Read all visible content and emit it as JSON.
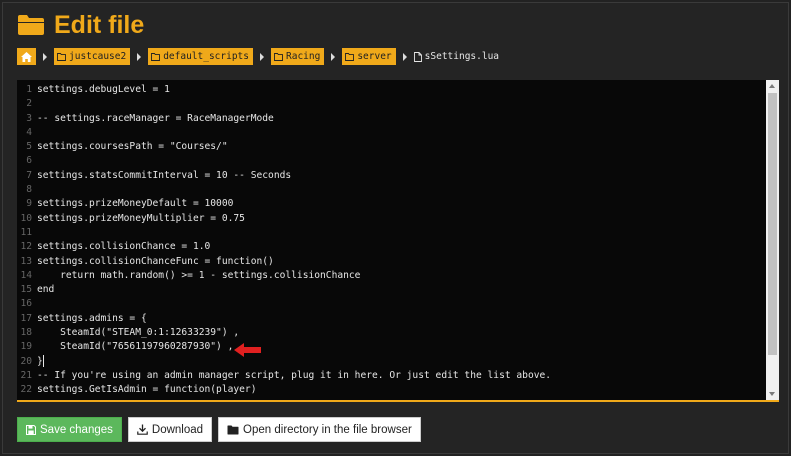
{
  "page": {
    "title": "Edit file"
  },
  "breadcrumb": {
    "folders": [
      "justcause2",
      "default_scripts",
      "Racing",
      "server"
    ],
    "current_file": "sSettings.lua"
  },
  "editor": {
    "lines": [
      {
        "n": "1",
        "text": "settings.debugLevel = 1"
      },
      {
        "n": "2",
        "text": ""
      },
      {
        "n": "3",
        "text": "-- settings.raceManager = RaceManagerMode"
      },
      {
        "n": "4",
        "text": ""
      },
      {
        "n": "5",
        "text": "settings.coursesPath = \"Courses/\""
      },
      {
        "n": "6",
        "text": ""
      },
      {
        "n": "7",
        "text": "settings.statsCommitInterval = 10 -- Seconds"
      },
      {
        "n": "8",
        "text": ""
      },
      {
        "n": "9",
        "text": "settings.prizeMoneyDefault = 10000"
      },
      {
        "n": "10",
        "text": "settings.prizeMoneyMultiplier = 0.75"
      },
      {
        "n": "11",
        "text": ""
      },
      {
        "n": "12",
        "text": "settings.collisionChance = 1.0"
      },
      {
        "n": "13",
        "text": "settings.collisionChanceFunc = function()"
      },
      {
        "n": "14",
        "text": "    return math.random() >= 1 - settings.collisionChance"
      },
      {
        "n": "15",
        "text": "end"
      },
      {
        "n": "16",
        "text": ""
      },
      {
        "n": "17",
        "text": "settings.admins = {"
      },
      {
        "n": "18",
        "text": "    SteamId(\"STEAM_0:1:12633239\") ,"
      },
      {
        "n": "19",
        "text": "    SteamId(\"76561197960287930\") ,"
      },
      {
        "n": "20",
        "text": "}"
      },
      {
        "n": "21",
        "text": "-- If you're using an admin manager script, plug it in here. Or just edit the list above."
      },
      {
        "n": "22",
        "text": "settings.GetIsAdmin = function(player)"
      }
    ]
  },
  "actions": {
    "save_label": "Save changes",
    "download_label": "Download",
    "open_dir_label": "Open directory in the file browser"
  },
  "colors": {
    "accent": "#f0a91a",
    "success": "#5cb85c",
    "annotation": "#e02020"
  }
}
